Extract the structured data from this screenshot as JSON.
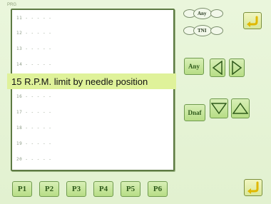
{
  "header": {
    "tiny_label": "PRG"
  },
  "list": {
    "items": [
      {
        "label": "11 - - - - -"
      },
      {
        "label": "12 - - - - -"
      },
      {
        "label": "13 - - - - -"
      },
      {
        "label": "14 - - - - -"
      },
      {
        "label": "16 - - - - -"
      },
      {
        "label": "17 - - - - -"
      },
      {
        "label": "18 - - - - -"
      },
      {
        "label": "19 - - - - -"
      },
      {
        "label": "20 - - - - -"
      }
    ],
    "selected": {
      "label": "15 R.P.M. limit by needle position"
    }
  },
  "mode_indicator": {
    "top_label": "Any",
    "bottom_label": "TNI"
  },
  "nav": {
    "horizontal_label": "Any",
    "vertical_label": "Dnaf"
  },
  "pages": [
    "P1",
    "P2",
    "P3",
    "P4",
    "P5",
    "P6"
  ],
  "colors": {
    "background": "#e2f1d0",
    "selection": "#dff29a",
    "button": "#b7dd86",
    "accent_yellow": "#f0d020"
  },
  "icons": {
    "top_right": "return-arrow-icon",
    "bottom_right": "enter-arrow-icon"
  }
}
